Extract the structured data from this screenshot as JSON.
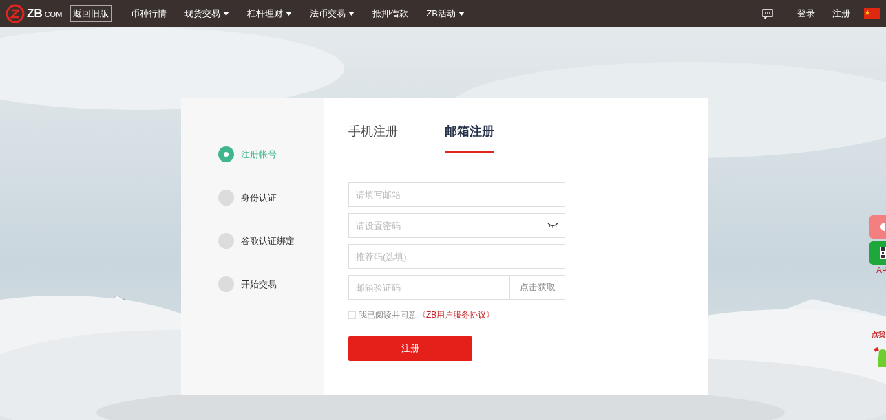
{
  "nav": {
    "logo": "ZB",
    "logo_suffix": "COM",
    "old_version": "返回旧版",
    "items": [
      {
        "label": "币种行情",
        "dropdown": false
      },
      {
        "label": "现货交易",
        "dropdown": true
      },
      {
        "label": "杠杆理财",
        "dropdown": true
      },
      {
        "label": "法币交易",
        "dropdown": true
      },
      {
        "label": "抵押借款",
        "dropdown": false
      },
      {
        "label": "ZB活动",
        "dropdown": true
      }
    ],
    "login": "登录",
    "register": "注册"
  },
  "steps": [
    {
      "label": "注册帐号",
      "selected": true
    },
    {
      "label": "身份认证",
      "selected": false
    },
    {
      "label": "谷歌认证绑定",
      "selected": false
    },
    {
      "label": "开始交易",
      "selected": false
    }
  ],
  "tabs": [
    {
      "label": "手机注册",
      "selected": false
    },
    {
      "label": "邮箱注册",
      "selected": true
    }
  ],
  "fields": [
    {
      "kind": "text",
      "placeholder": "请填写邮箱"
    },
    {
      "kind": "password",
      "placeholder": "请设置密码"
    },
    {
      "kind": "text",
      "placeholder": "推荐码(选填)"
    },
    {
      "kind": "code",
      "placeholder": "邮箱验证码",
      "button": "点击获取"
    }
  ],
  "agreement": {
    "checked": false,
    "text": "我已阅读并同意",
    "link": "《ZB用户服务协议》"
  },
  "submit": "注册",
  "side": {
    "app_label": "AP",
    "promo": "点我"
  }
}
